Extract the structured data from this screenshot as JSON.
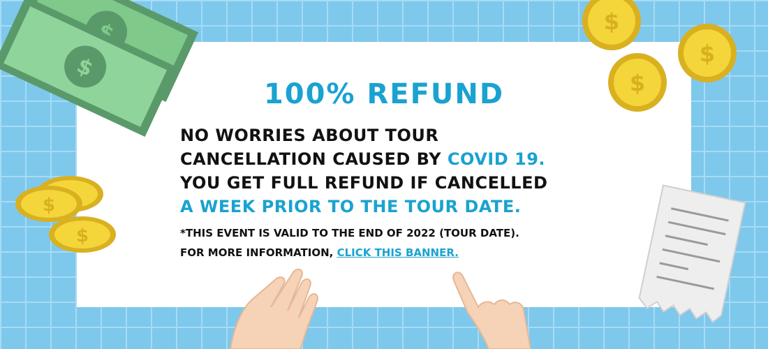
{
  "banner": {
    "headline": "100% REFUND",
    "body": [
      {
        "parts": [
          {
            "text": "NO WORRIES ABOUT TOUR",
            "highlight": false
          }
        ]
      },
      {
        "parts": [
          {
            "text": "CANCELLATION CAUSED BY ",
            "highlight": false
          },
          {
            "text": "COVID 19.",
            "highlight": true
          }
        ]
      },
      {
        "parts": [
          {
            "text": "YOU GET FULL REFUND IF CANCELLED",
            "highlight": false
          }
        ]
      },
      {
        "parts": [
          {
            "text": "A WEEK PRIOR TO THE TOUR DATE.",
            "highlight": true
          }
        ]
      }
    ],
    "note_line1": "*THIS EVENT IS VALID TO THE END OF 2022 (TOUR DATE).",
    "note_line2_prefix": "FOR MORE INFORMATION, ",
    "note_link": "CLICK THIS BANNER.",
    "coin_symbol": "$"
  },
  "colors": {
    "background": "#7ec8ec",
    "accent": "#1aa2d0",
    "text": "#111111",
    "money": "#7fc98a",
    "coin": "#f4d53a"
  }
}
